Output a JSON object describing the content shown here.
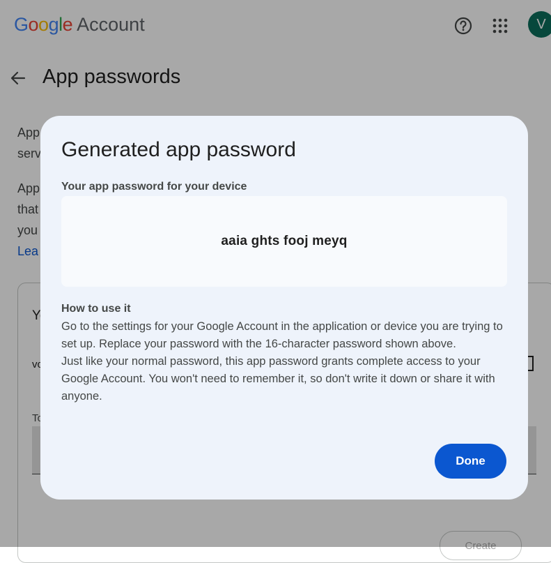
{
  "header": {
    "logo_google": "Google",
    "logo_account": "Account",
    "avatar_initial": "V",
    "icons": [
      "help-icon",
      "apps-grid-icon"
    ]
  },
  "page": {
    "title": "App passwords",
    "back_icon": "arrow-back-icon",
    "intro_line1": "App",
    "intro_line2": "serv",
    "intro_line3": "App",
    "intro_line4": "that",
    "intro_line5": "you",
    "learn_more": "Lea",
    "card_heading": "Yo",
    "card_row": "vc",
    "card_field_label": "To",
    "create_button": "Create"
  },
  "dialog": {
    "title": "Generated app password",
    "password_label": "Your app password for your device",
    "password": "aaia ghts fooj meyq",
    "howto_heading": "How to use it",
    "howto_paragraph1": "Go to the settings for your Google Account in the application or device you are trying to set up. Replace your password with the 16-character password shown above.",
    "howto_paragraph2": "Just like your normal password, this app password grants complete access to your Google Account. You won't need to remember it, so don't write it down or share it with anyone.",
    "done_label": "Done"
  },
  "colors": {
    "accent": "#0b57d0",
    "avatar": "#0b6e5b",
    "dialog_bg": "#eef3fb",
    "google_blue": "#4285f4",
    "google_red": "#ea4335",
    "google_yellow": "#fbbc05",
    "google_green": "#34a853"
  }
}
